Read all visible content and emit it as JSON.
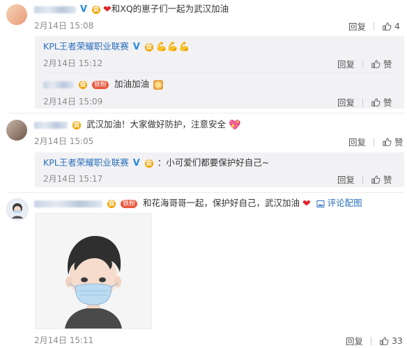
{
  "comments": [
    {
      "text": "和XQ的崽子们一起为武汉加油",
      "time": "2月14日 15:08",
      "reply_label": "回复",
      "likes": "4",
      "replies": [
        {
          "name": "KPL王者荣耀职业联赛",
          "text": "",
          "time": "2月14日 15:12",
          "reply_label": "回复",
          "like_label": "赞"
        },
        {
          "badge": "铁粉",
          "text": "加油加油",
          "time": "2月14日 15:09",
          "reply_label": "回复",
          "like_label": "赞"
        }
      ]
    },
    {
      "text": "武汉加油！大家做好防护，注意安全",
      "time": "2月14日 15:05",
      "reply_label": "回复",
      "like_label": "赞",
      "replies": [
        {
          "name": "KPL王者荣耀职业联赛",
          "text": "小可爱们都要保护好自己~",
          "time": "2月14日 15:17",
          "reply_label": "回复",
          "like_label": "赞"
        }
      ]
    },
    {
      "badge": "铁粉",
      "text": "和花海哥哥一起，保护好自己，武汉加油",
      "pic_link": "评论配图",
      "time": "2月14日 15:11",
      "reply_label": "回复",
      "likes": "33"
    }
  ],
  "icons": {
    "verified": "verified-v-icon",
    "heart": "heart-icon",
    "thumb": "thumb-up-icon",
    "picture": "picture-icon"
  },
  "colors": {
    "link_blue": "#2a6fba",
    "badge_red": "#e9583e",
    "heart_red": "#e0272e"
  }
}
